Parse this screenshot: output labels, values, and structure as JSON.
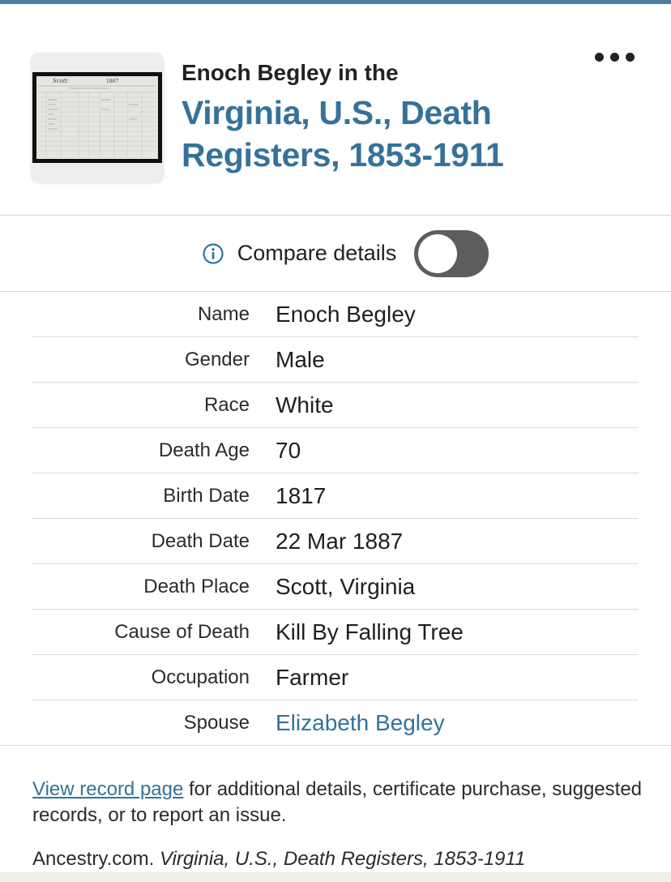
{
  "header": {
    "title_prefix": "Enoch Begley in the",
    "collection_title": "Virginia, U.S., Death Registers, 1853-1911",
    "more_icon": "more-horizontal-icon",
    "thumbnail_marks": [
      "Scott",
      "1887"
    ]
  },
  "compare": {
    "label": "Compare details",
    "toggle_on": false,
    "info_icon": "info-icon"
  },
  "details": [
    {
      "label": "Name",
      "value": "Enoch Begley"
    },
    {
      "label": "Gender",
      "value": "Male"
    },
    {
      "label": "Race",
      "value": "White"
    },
    {
      "label": "Death Age",
      "value": "70"
    },
    {
      "label": "Birth Date",
      "value": "1817"
    },
    {
      "label": "Death Date",
      "value": "22 Mar 1887"
    },
    {
      "label": "Death Place",
      "value": "Scott, Virginia"
    },
    {
      "label": "Cause of Death",
      "value": "Kill By Falling Tree"
    },
    {
      "label": "Occupation",
      "value": "Farmer"
    },
    {
      "label": "Spouse",
      "value": "Elizabeth Begley"
    }
  ],
  "note": {
    "link_text": "View record page",
    "rest_text": " for additional details, certificate purchase, suggested records, or to report an issue."
  },
  "citation": {
    "source": "Ancestry.com. ",
    "title": "Virginia, U.S., Death Registers, 1853-1911"
  },
  "colors": {
    "accent": "#35729a",
    "top_bar": "#4a7ea7",
    "toggle_off": "#5d5d5d"
  }
}
